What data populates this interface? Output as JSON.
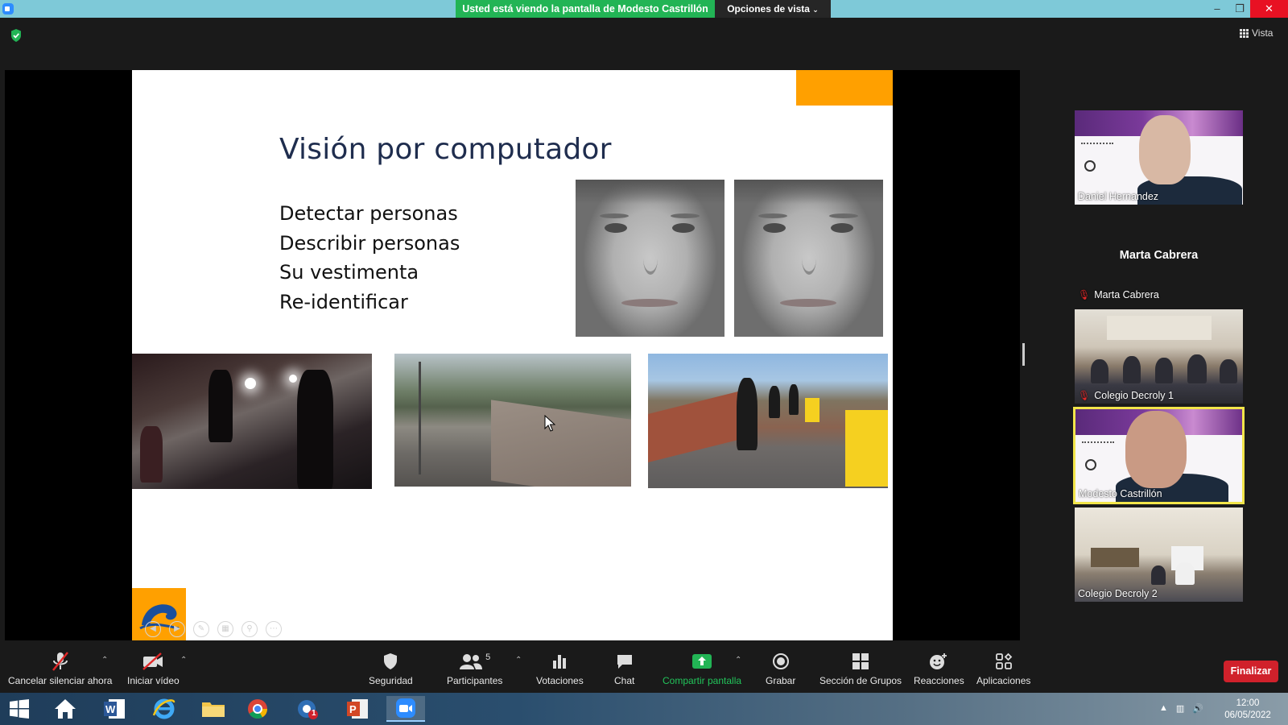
{
  "titlebar": {
    "viewing_banner": "Usted está viendo la pantalla de Modesto Castrillón",
    "view_options": "Opciones de vista",
    "minimize": "–",
    "maximize": "❐",
    "close": "✕"
  },
  "top": {
    "vista_label": "Vista"
  },
  "slide": {
    "title": "Visión por computador",
    "bullets": [
      "Detectar personas",
      "Describir personas",
      "Su vestimenta",
      "Re-identificar"
    ]
  },
  "participants": [
    {
      "name": "Daniel Hernandez",
      "muted": false
    },
    {
      "name": "Marta Cabrera",
      "muted": true,
      "video": false
    },
    {
      "name": "Colegio Decroly 1",
      "muted": true
    },
    {
      "name": "Modesto Castrillón",
      "muted": false,
      "active_speaker": true
    },
    {
      "name": "Colegio Decroly 2",
      "muted": false
    }
  ],
  "toolbar": {
    "mute_label": "Cancelar silenciar ahora",
    "video_label": "Iniciar vídeo",
    "security_label": "Seguridad",
    "participants_label": "Participantes",
    "participants_count": "5",
    "polls_label": "Votaciones",
    "chat_label": "Chat",
    "share_label": "Compartir pantalla",
    "record_label": "Grabar",
    "breakout_label": "Sección de Grupos",
    "reactions_label": "Reacciones",
    "apps_label": "Aplicaciones",
    "end_label": "Finalizar"
  },
  "taskbar": {
    "time": "12:00",
    "date": "06/05/2022",
    "outlook_badge": "1"
  },
  "colors": {
    "banner_green": "#22b455",
    "accent_orange": "#ffa000",
    "share_green": "#22b455",
    "end_red": "#d0212b",
    "speaker_highlight": "#f2e54a"
  }
}
